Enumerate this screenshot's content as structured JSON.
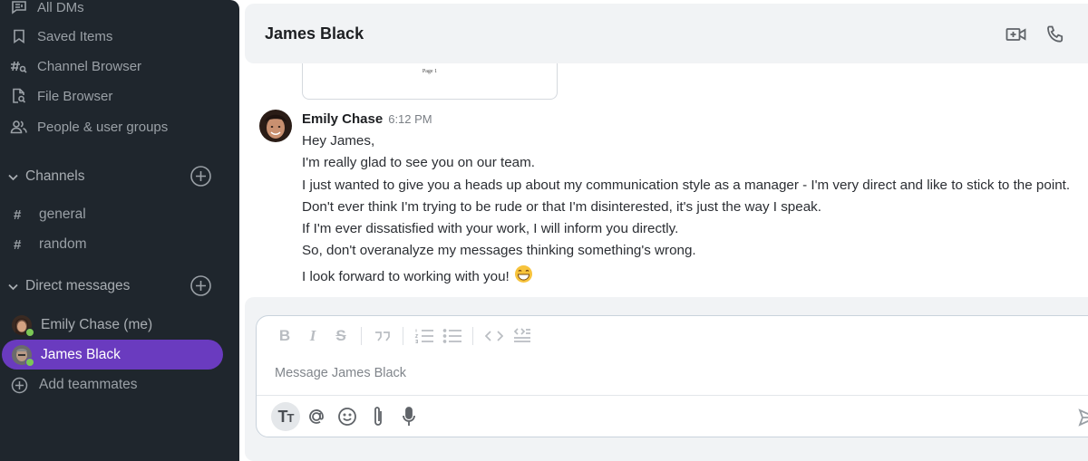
{
  "sidebar": {
    "nav": [
      {
        "label": "All DMs",
        "icon": "all-dms-icon"
      },
      {
        "label": "Saved Items",
        "icon": "bookmark-icon"
      },
      {
        "label": "Channel Browser",
        "icon": "channel-search-icon"
      },
      {
        "label": "File Browser",
        "icon": "file-search-icon"
      },
      {
        "label": "People & user groups",
        "icon": "people-icon"
      }
    ],
    "channels_section": {
      "label": "Channels",
      "add_icon": "add-circle-icon"
    },
    "channels": [
      {
        "name": "general",
        "prefix": "#"
      },
      {
        "name": "random",
        "prefix": "#"
      }
    ],
    "dm_section": {
      "label": "Direct messages",
      "add_icon": "add-circle-icon"
    },
    "dms": [
      {
        "name": "Emily Chase (me)",
        "status": "online",
        "active": false
      },
      {
        "name": "James Black",
        "status": "online",
        "active": true
      }
    ],
    "add_teammates": "Add teammates",
    "active_color": "#6a3bbf",
    "online_color": "#7bc855"
  },
  "header": {
    "title": "James Black",
    "actions": [
      {
        "icon": "video-call-icon"
      },
      {
        "icon": "phone-icon"
      }
    ]
  },
  "attachment": {
    "label": "Page 1"
  },
  "message": {
    "author": "Emily Chase",
    "time": "6:12 PM",
    "lines": [
      "Hey James,",
      "I'm really glad to see you on our team.",
      "I just wanted to give you a heads up about my communication style as a manager - I'm very direct and like to stick to the point.",
      "Don't ever think I'm trying to be rude or that I'm disinterested, it's just the way I speak.",
      "If I'm ever dissatisfied with your work, I will inform you directly.",
      "So, don't overanalyze my messages thinking something's wrong.",
      "I look forward to working with you!"
    ],
    "emoji": "grinning-face-with-smiling-eyes"
  },
  "composer": {
    "placeholder": "Message James Black",
    "value": "",
    "format_toolbar": [
      "bold",
      "italic",
      "strikethrough",
      "quote",
      "ordered-list",
      "bulleted-list",
      "code",
      "code-block"
    ],
    "format_labels": {
      "bold": "B",
      "italic": "I",
      "strikethrough": "S"
    },
    "actions": [
      "text-format",
      "mention",
      "emoji",
      "attach",
      "microphone"
    ],
    "text_format_label": "T"
  }
}
